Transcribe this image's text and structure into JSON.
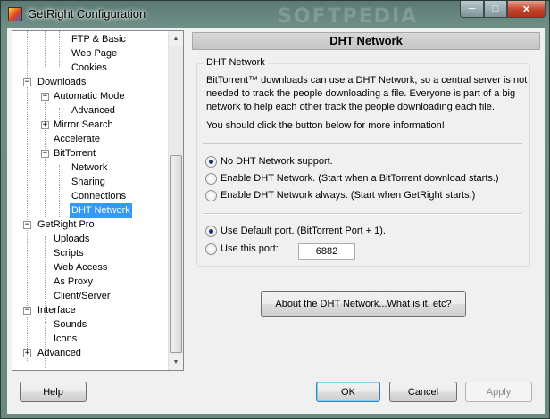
{
  "window": {
    "title": "GetRight Configuration",
    "min_symbol": "─",
    "max_symbol": "□",
    "close_symbol": "✕",
    "watermark": "SOFTPEDIA"
  },
  "tree": {
    "items": [
      {
        "label": "FTP & Basic",
        "level": 2
      },
      {
        "label": "Web Page",
        "level": 2
      },
      {
        "label": "Cookies",
        "level": 2
      },
      {
        "label": "Downloads",
        "level": 0,
        "toggle": "−"
      },
      {
        "label": "Automatic Mode",
        "level": 1,
        "toggle": "−"
      },
      {
        "label": "Advanced",
        "level": 2
      },
      {
        "label": "Mirror Search",
        "level": 1,
        "toggle": "+"
      },
      {
        "label": "Accelerate",
        "level": 1
      },
      {
        "label": "BitTorrent",
        "level": 1,
        "toggle": "−"
      },
      {
        "label": "Network",
        "level": 2
      },
      {
        "label": "Sharing",
        "level": 2
      },
      {
        "label": "Connections",
        "level": 2
      },
      {
        "label": "DHT Network",
        "level": 2,
        "selected": true
      },
      {
        "label": "GetRight Pro",
        "level": 0,
        "toggle": "−"
      },
      {
        "label": "Uploads",
        "level": 1
      },
      {
        "label": "Scripts",
        "level": 1
      },
      {
        "label": "Web Access",
        "level": 1
      },
      {
        "label": "As Proxy",
        "level": 1
      },
      {
        "label": "Client/Server",
        "level": 1
      },
      {
        "label": "Interface",
        "level": 0,
        "toggle": "−"
      },
      {
        "label": "Sounds",
        "level": 1
      },
      {
        "label": "Icons",
        "level": 1
      },
      {
        "label": "Advanced",
        "level": 0,
        "toggle": "+"
      }
    ]
  },
  "panel": {
    "header": "DHT Network",
    "group_label": "DHT Network",
    "description": "BitTorrent™ downloads can use a DHT Network, so a central server is not needed to track the people downloading a file.  Everyone is part of a big network to help each other track the people downloading each file.",
    "more_info": "You should click the button below for more information!",
    "mode_options": [
      {
        "label": "No DHT Network support.",
        "checked": true
      },
      {
        "label": "Enable DHT Network.  (Start when a BitTorrent download starts.)",
        "checked": false
      },
      {
        "label": "Enable DHT Network always.  (Start when GetRight starts.)",
        "checked": false
      }
    ],
    "port_options": [
      {
        "label": "Use Default port.  (BitTorrent Port + 1).",
        "checked": true
      },
      {
        "label": "Use this port:",
        "checked": false
      }
    ],
    "port_value": "6882",
    "about_button": "About the DHT Network...What is it, etc?"
  },
  "footer": {
    "help": "Help",
    "ok": "OK",
    "cancel": "Cancel",
    "apply": "Apply"
  }
}
